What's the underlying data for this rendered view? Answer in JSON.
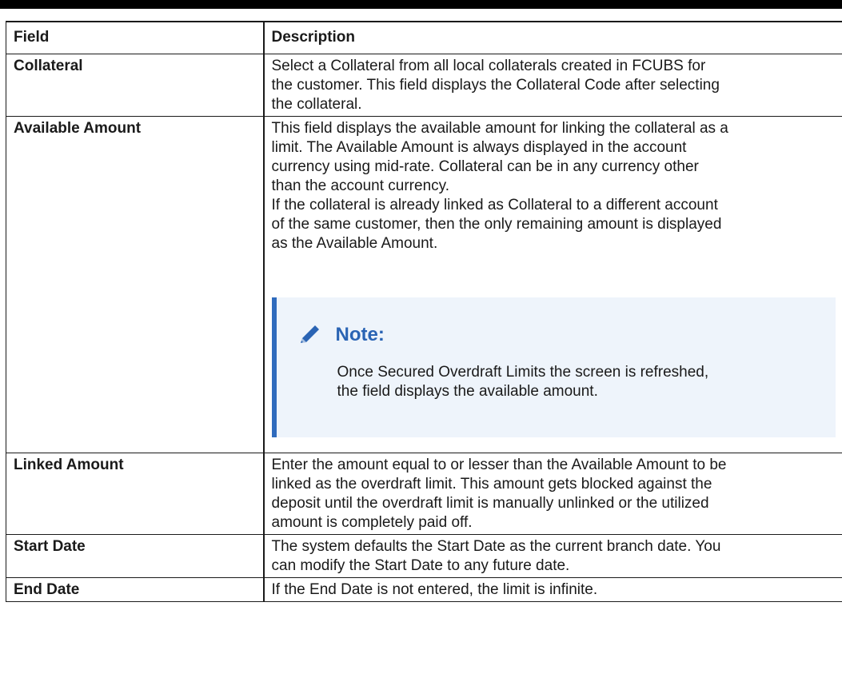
{
  "table": {
    "headers": {
      "field": "Field",
      "description": "Description"
    },
    "rows": [
      {
        "field": "Collateral",
        "lines": [
          "Select a Collateral from all local collaterals created in FCUBS for",
          "the customer. This field displays the Collateral Code after selecting",
          "the collateral."
        ]
      },
      {
        "field": "Available Amount",
        "lines": [
          "This field displays the available amount for linking the collateral as a",
          "limit. The Available Amount is always displayed in the account",
          "currency using mid-rate. Collateral can be in any currency other",
          "than the account currency.",
          "If the collateral is already linked as Collateral to a different account",
          "of the same customer, then the only remaining amount is displayed",
          "as the Available Amount."
        ],
        "note": {
          "icon": "pencil-icon",
          "title": "Note:",
          "lines": [
            "Once Secured Overdraft Limits the screen is refreshed,",
            "the field displays the available amount."
          ]
        }
      },
      {
        "field": "Linked Amount",
        "lines": [
          "Enter the amount equal to or lesser than the Available Amount to be",
          "linked as the overdraft limit. This amount gets blocked against the",
          "deposit until the overdraft limit is manually unlinked or the utilized",
          "amount is completely paid off."
        ]
      },
      {
        "field": "Start Date",
        "lines": [
          "The system defaults the Start Date as the current branch date. You",
          "can modify the Start Date to any future date."
        ]
      },
      {
        "field": "End Date",
        "lines": [
          "If the End Date is not entered, the limit is infinite."
        ]
      }
    ]
  },
  "colors": {
    "note_accent": "#2f6bbd",
    "note_background": "#eef4fb",
    "note_title": "#2a64b4"
  }
}
